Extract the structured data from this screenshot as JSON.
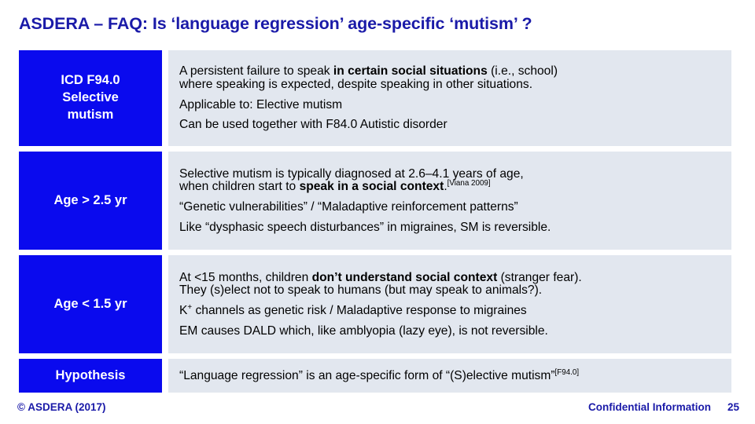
{
  "slide": {
    "title": "ASDERA – FAQ: Is ‘language regression’ age-specific ‘mutism’ ?"
  },
  "table": {
    "rows": [
      {
        "label": "ICD F94.0\nSelective\nmutism",
        "label_lines": [
          "ICD F94.0",
          "Selective",
          "mutism"
        ],
        "lines": [
          {
            "pre": "A persistent failure to speak ",
            "bold": "in certain social situations",
            "post": " (i.e., school)"
          },
          {
            "pre": "where speaking is expected, despite speaking in other situations.",
            "bold": "",
            "post": ""
          },
          {
            "pre": "Applicable to: Elective mutism",
            "bold": "",
            "post": ""
          },
          {
            "pre": "Can be used together with F84.0 Autistic disorder",
            "bold": "",
            "post": ""
          }
        ]
      },
      {
        "label": "Age > 2.5 yr",
        "label_lines": [
          "Age > 2.5 yr"
        ],
        "lines": [
          {
            "pre": "Selective mutism is typically diagnosed at 2.6–4.1 years of age,",
            "bold": "",
            "post": ""
          },
          {
            "pre": "when children start to ",
            "bold": "speak in a social context",
            "post": ".",
            "sup": "[Viana 2009]"
          },
          {
            "pre": "“Genetic vulnerabilities” / “Maladaptive reinforcement patterns”",
            "bold": "",
            "post": ""
          },
          {
            "pre": "Like “dysphasic speech disturbances” in migraines, SM is reversible.",
            "bold": "",
            "post": ""
          }
        ]
      },
      {
        "label": "Age < 1.5 yr",
        "label_lines": [
          "Age < 1.5 yr"
        ],
        "lines": [
          {
            "pre": "At <15 months, children ",
            "bold": "don’t understand social context",
            "post": " (stranger fear)."
          },
          {
            "pre": "They (s)elect not to speak to humans (but may speak to animals?).",
            "bold": "",
            "post": ""
          },
          {
            "pre": "K",
            "sup_inline": "+",
            "post": " channels as genetic risk / Maladaptive response to migraines",
            "bold": ""
          },
          {
            "pre": "EM causes DALD which, like amblyopia (lazy eye), is not reversible.",
            "bold": "",
            "post": ""
          }
        ]
      },
      {
        "label": "Hypothesis",
        "label_lines": [
          "Hypothesis"
        ],
        "lines": [
          {
            "pre": "“Language regression” is an age-specific form of “(S)elective mutism”",
            "bold": "",
            "post": "",
            "sup": "[F94.0]"
          }
        ]
      }
    ]
  },
  "footer": {
    "copyright": "© ASDERA (2017)",
    "confidential": "Confidential Information",
    "page_number": "25"
  },
  "colors": {
    "label_blue": "#0A0AEE",
    "body_panel": "#E2E7EF",
    "title_navy": "#1A1AA8",
    "background": "#FFFFFF"
  }
}
